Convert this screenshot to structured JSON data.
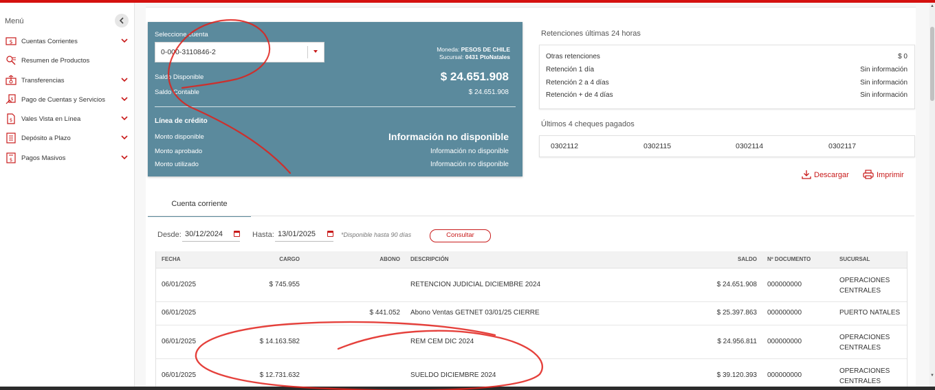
{
  "sidebar": {
    "title": "Menú",
    "items": [
      {
        "label": "Cuentas Corrientes",
        "icon": "checkbook-icon",
        "has_submenu": true
      },
      {
        "label": "Resumen de Productos",
        "icon": "search-list-icon",
        "has_submenu": false
      },
      {
        "label": "Transferencias",
        "icon": "transfer-icon",
        "has_submenu": true
      },
      {
        "label": "Pago de Cuentas y Servicios",
        "icon": "bill-payment-icon",
        "has_submenu": true
      },
      {
        "label": "Vales Vista en Línea",
        "icon": "voucher-icon",
        "has_submenu": true
      },
      {
        "label": "Depósito a Plazo",
        "icon": "document-icon",
        "has_submenu": true
      },
      {
        "label": "Pagos Masivos",
        "icon": "bulk-payment-icon",
        "has_submenu": true
      }
    ]
  },
  "account": {
    "select_label": "Seleccione cuenta",
    "selected_account": "0-000-3110846-2",
    "currency_label": "Moneda:",
    "currency_value": "PESOS DE CHILE",
    "branch_label": "Sucursal:",
    "branch_value": "0431 PtoNatales",
    "saldo_disponible_label": "Saldo Disponible",
    "saldo_disponible_value": "$ 24.651.908",
    "saldo_contable_label": "Saldo Contable",
    "saldo_contable_value": "$ 24.651.908",
    "credit_title": "Línea de crédito",
    "monto_disponible_label": "Monto disponible",
    "monto_disponible_value": "Información no disponible",
    "monto_aprobado_label": "Monto aprobado",
    "monto_aprobado_value": "Información no disponible",
    "monto_utilizado_label": "Monto utilizado",
    "monto_utilizado_value": "Información no disponible"
  },
  "retenciones": {
    "title": "Retenciones últimas 24 horas",
    "rows": [
      {
        "label": "Otras retenciones",
        "value": "$ 0"
      },
      {
        "label": "Retención 1 día",
        "value": "Sin información"
      },
      {
        "label": "Retención 2 a 4 días",
        "value": "Sin información"
      },
      {
        "label": "Retención + de 4 días",
        "value": "Sin información"
      }
    ]
  },
  "cheques": {
    "title": "Últimos 4 cheques pagados",
    "items": [
      "0302112",
      "0302115",
      "0302114",
      "0302117"
    ]
  },
  "actions": {
    "download_label": "Descargar",
    "print_label": "Imprimir"
  },
  "tabs": [
    {
      "label": "Cuenta corriente",
      "active": true
    }
  ],
  "filters": {
    "desde_label": "Desde:",
    "desde_value": "30/12/2024",
    "hasta_label": "Hasta:",
    "hasta_value": "13/01/2025",
    "note": "*Disponible hasta 90 días",
    "consultar_label": "Consultar"
  },
  "table": {
    "headers": {
      "fecha": "FECHA",
      "cargo": "CARGO",
      "abono": "ABONO",
      "descripcion": "DESCRIPCIÓN",
      "saldo": "SALDO",
      "documento": "Nº DOCUMENTO",
      "sucursal": "SUCURSAL"
    },
    "rows": [
      {
        "fecha": "06/01/2025",
        "cargo": "$ 745.955",
        "abono": "",
        "descripcion": "RETENCION JUDICIAL DICIEMBRE 2024",
        "saldo": "$ 24.651.908",
        "documento": "000000000",
        "sucursal": "OPERACIONES CENTRALES"
      },
      {
        "fecha": "06/01/2025",
        "cargo": "",
        "abono": "$ 441.052",
        "descripcion": "Abono Ventas GETNET 03/01/25 CIERRE",
        "saldo": "$ 25.397.863",
        "documento": "000000000",
        "sucursal": "PUERTO NATALES"
      },
      {
        "fecha": "06/01/2025",
        "cargo": "$ 14.163.582",
        "abono": "",
        "descripcion": "REM CEM DIC 2024",
        "saldo": "$ 24.956.811",
        "documento": "000000000",
        "sucursal": "OPERACIONES CENTRALES"
      },
      {
        "fecha": "06/01/2025",
        "cargo": "$ 12.731.632",
        "abono": "",
        "descripcion": "SUELDO DICIEMBRE 2024",
        "saldo": "$ 39.120.393",
        "documento": "000000000",
        "sucursal": "OPERACIONES CENTRALES"
      }
    ]
  },
  "colors": {
    "brand_red": "#c81919",
    "card_teal": "#5b8a9d"
  }
}
